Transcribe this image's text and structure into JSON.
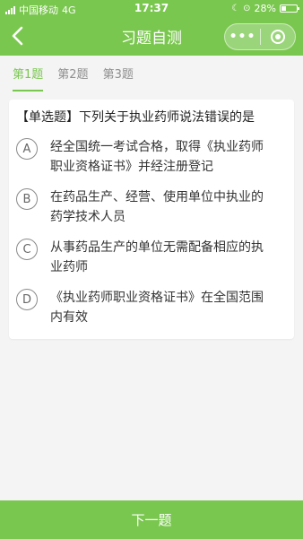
{
  "statusbar": {
    "carrier": "中国移动",
    "network": "4G",
    "time": "17:37",
    "battery": "28%"
  },
  "navbar": {
    "title": "习题自测",
    "more_glyph": "•••"
  },
  "tabs": [
    {
      "label": "第1题"
    },
    {
      "label": "第2题"
    },
    {
      "label": "第3题"
    }
  ],
  "question": {
    "text": "【单选题】下列关于执业药师说法错误的是",
    "options": [
      {
        "letter": "A",
        "text": "经全国统一考试合格，取得《执业药师职业资格证书》并经注册登记"
      },
      {
        "letter": "B",
        "text": "在药品生产、经营、使用单位中执业的药学技术人员"
      },
      {
        "letter": "C",
        "text": "从事药品生产的单位无需配备相应的执业药师"
      },
      {
        "letter": "D",
        "text": "《执业药师职业资格证书》在全国范围内有效"
      }
    ]
  },
  "footer": {
    "next_label": "下一题"
  },
  "colors": {
    "accent": "#7ac74f",
    "background": "#f4f4f4"
  }
}
